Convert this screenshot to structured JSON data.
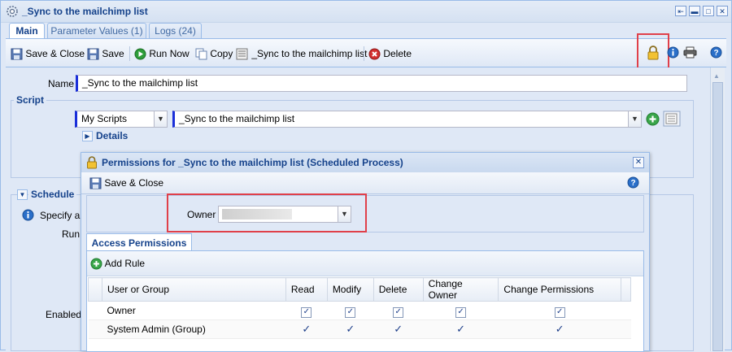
{
  "window": {
    "title": "_Sync to the mailchimp list"
  },
  "tabs": [
    {
      "label": "Main"
    },
    {
      "label": "Parameter Values (1)"
    },
    {
      "label": "Logs (24)"
    }
  ],
  "toolbar": {
    "save_close": "Save & Close",
    "save": "Save",
    "run_now": "Run Now",
    "copy": "Copy",
    "script_link": "_Sync to the mailchimp list",
    "delete": "Delete"
  },
  "form": {
    "name_label": "Name",
    "name_value": "_Sync to the mailchimp list",
    "script_legend": "Script",
    "script_folder": "My Scripts",
    "script_value": "_Sync to the mailchimp list",
    "details_label": "Details",
    "schedule_legend": "Schedule",
    "specify_text": "Specify a s",
    "run_label": "Run",
    "enabled_label": "Enabled"
  },
  "dialog": {
    "title": "Permissions for _Sync to the mailchimp list (Scheduled Process)",
    "save_close": "Save & Close",
    "owner_label": "Owner",
    "owner_value": "",
    "tab_label": "Access Permissions",
    "add_rule": "Add Rule",
    "columns": [
      "User or Group",
      "Read",
      "Modify",
      "Delete",
      "Change Owner",
      "Change Permissions"
    ],
    "rows": [
      {
        "name": "Owner",
        "read": "✓",
        "modify": "✓",
        "delete": "✓",
        "change_owner": "✓",
        "change_permissions": "✓"
      },
      {
        "name": "System Admin (Group)",
        "read": "✓",
        "modify": "✓",
        "delete": "✓",
        "change_owner": "✓",
        "change_permissions": "✓"
      }
    ]
  },
  "colors": {
    "highlight": "#e0404a",
    "title_text": "#15428b",
    "required_marker": "#1a2fd9"
  }
}
